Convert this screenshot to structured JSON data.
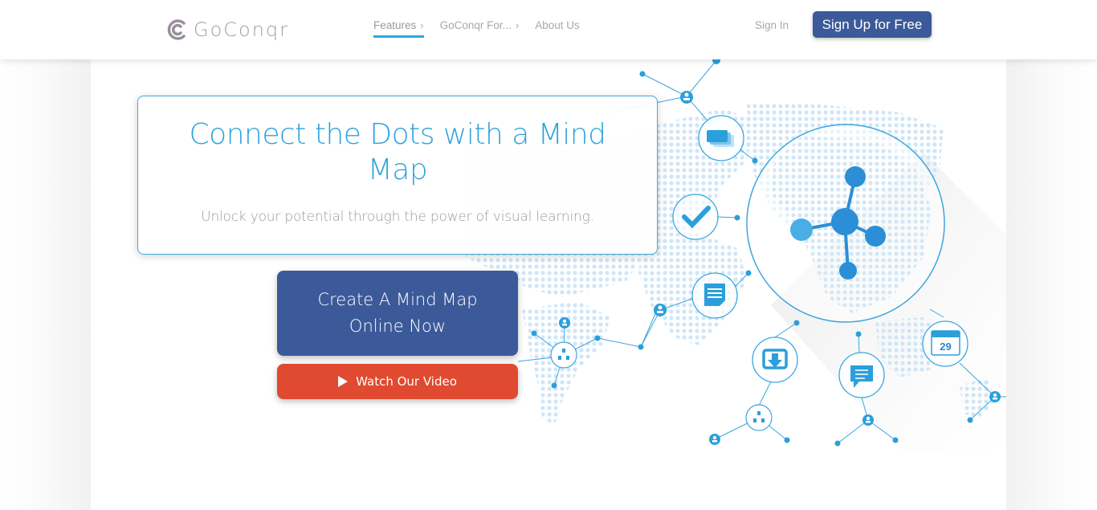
{
  "header": {
    "logo_text": "GoConqr",
    "nav": [
      {
        "label": "Features",
        "active": true
      },
      {
        "label": "GoConqr For...",
        "active": false
      },
      {
        "label": "About Us",
        "active": false
      }
    ],
    "sign_in": "Sign In",
    "sign_up": "Sign Up for Free"
  },
  "hero": {
    "title": "Connect the Dots with a Mind Map",
    "subtitle": "Unlock your potential through the power of visual learning.",
    "cta_primary": "Create A Mind Map Online Now",
    "cta_video": "Watch Our Video"
  },
  "illustration": {
    "calendar_day": "29",
    "icons": [
      "flashcards-icon",
      "checkmark-icon",
      "note-icon",
      "download-icon",
      "chat-icon",
      "calendar-icon",
      "hierarchy-icon",
      "user-icon",
      "globe-icon",
      "mind-map-molecule-icon"
    ]
  },
  "colors": {
    "accent_blue": "#2fa3dc",
    "primary_button": "#3c5a9a",
    "video_button": "#e04a30",
    "nav_underline": "#29a8df"
  }
}
